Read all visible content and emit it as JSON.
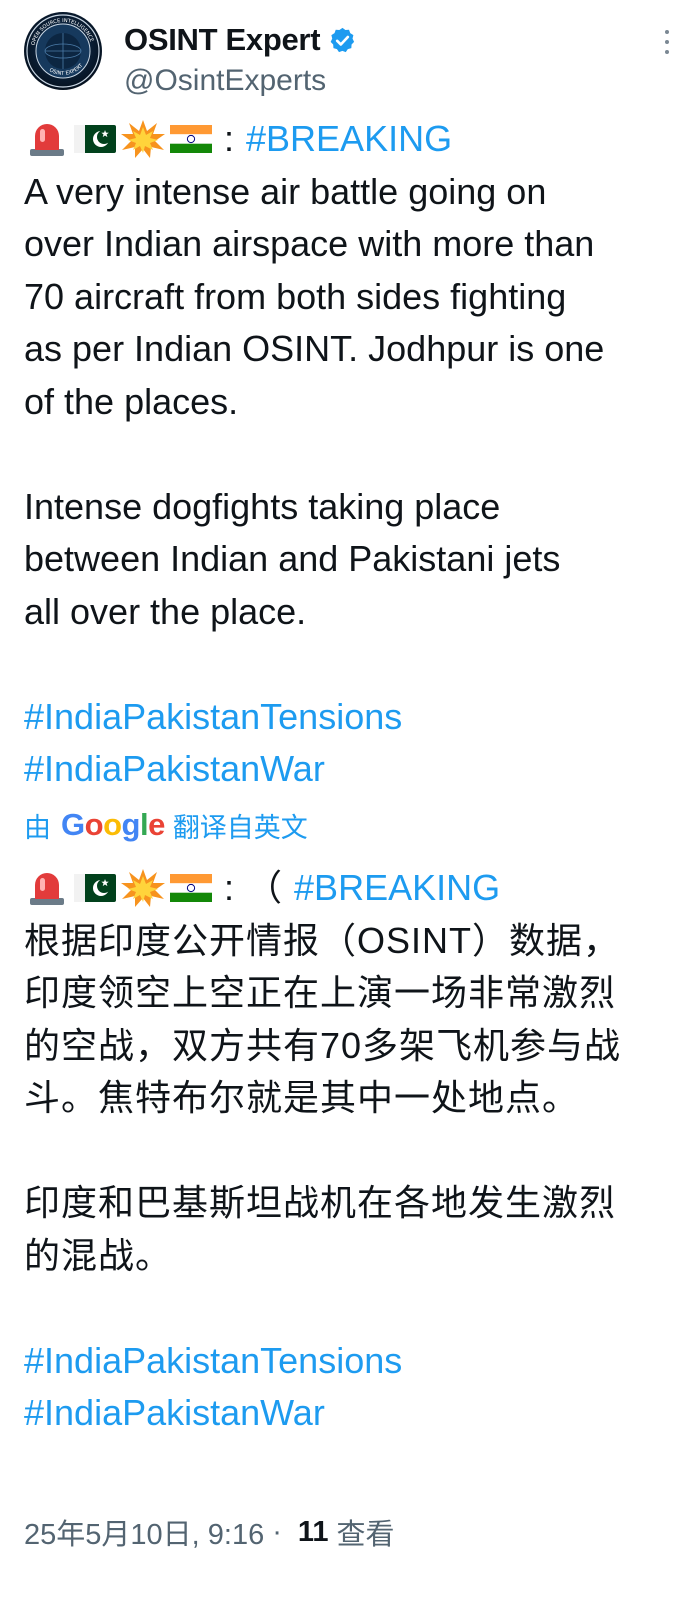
{
  "author": {
    "name": "OSINT Expert",
    "handle": "@OsintExperts",
    "avatar_text": "OPEN SOURCE INTELLIGENCE · OSINT EXPERT",
    "verified_color": "#1d9bf0"
  },
  "tweet": {
    "breaking_tag": "#BREAKING",
    "colon": ":",
    "body_lines": [
      "A very intense air battle going on",
      "over Indian airspace with more than",
      "70 aircraft from both sides fighting",
      "as per Indian OSINT. Jodhpur is one",
      "of the places."
    ],
    "body2_lines": [
      "Intense dogfights taking place",
      "between Indian and Pakistani jets",
      "all over the place."
    ],
    "hashtags": [
      "#IndiaPakistanTensions",
      "#IndiaPakistanWar"
    ],
    "emojis": [
      "rotating-light",
      "pakistan-flag",
      "collision",
      "india-flag"
    ]
  },
  "translation": {
    "by": "由",
    "google": "Google",
    "from": "翻译自英文",
    "paren": "（",
    "breaking_tag": "#BREAKING",
    "lines": [
      "根据印度公开情报（OSINT）数据，",
      "印度领空上空正在上演一场非常激烈",
      "的空战，双方共有70多架飞机参与战",
      "斗。焦特布尔就是其中一处地点。"
    ],
    "lines2": [
      "印度和巴基斯坦战机在各地发生激烈",
      "的混战。"
    ],
    "hashtags": [
      "#IndiaPakistanTensions",
      "#IndiaPakistanWar"
    ]
  },
  "meta": {
    "timestamp": "25年5月10日, 9:16",
    "separator": "·",
    "views": "11",
    "views_label": "查看"
  },
  "colors": {
    "link": "#1d9bf0",
    "text": "#0f1419",
    "secondary": "#536471"
  }
}
